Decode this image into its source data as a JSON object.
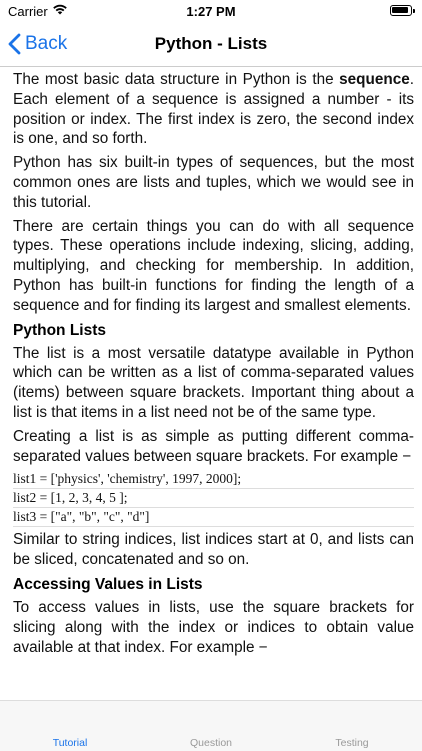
{
  "status": {
    "carrier": "Carrier",
    "time": "1:27 PM"
  },
  "nav": {
    "back_label": "Back",
    "title": "Python - Lists"
  },
  "content": {
    "p1_part1": "The most basic data structure in Python is the ",
    "p1_bold": "sequence",
    "p1_part2": ". Each element of a sequence is assigned a number - its position or index. The first index is zero, the second index is one, and so forth.",
    "p2": "Python has six built-in types of sequences, but the most common ones are lists and tuples, which we would see in this tutorial.",
    "p3": "There are certain things you can do with all sequence types. These operations include indexing, slicing, adding, multiplying, and checking for membership. In addition, Python has built-in functions for finding the length of a sequence and for finding its largest and smallest elements.",
    "h_lists": "Python Lists",
    "p4": "The list is a most versatile datatype available in Python which can be written as a list of comma-separated values (items) between square brackets. Important thing about a list is that items in a list need not be of the same type.",
    "p5": "Creating a list is as simple as putting different comma-separated values between square brackets. For example −",
    "code": [
      "list1 = ['physics', 'chemistry', 1997, 2000];",
      "list2 = [1, 2, 3, 4, 5 ];",
      "list3 = [\"a\", \"b\", \"c\", \"d\"]"
    ],
    "p6": "Similar to string indices, list indices start at 0, and lists can be sliced, concatenated and so on.",
    "h_access": "Accessing Values in Lists",
    "p7": "To access values in lists, use the square brackets for slicing along with the index or indices to obtain value available at that index. For example −"
  },
  "tabs": {
    "tutorial": "Tutorial",
    "question": "Question",
    "testing": "Testing"
  },
  "colors": {
    "accent": "#1a73e8",
    "inactive_tab": "#999999"
  }
}
